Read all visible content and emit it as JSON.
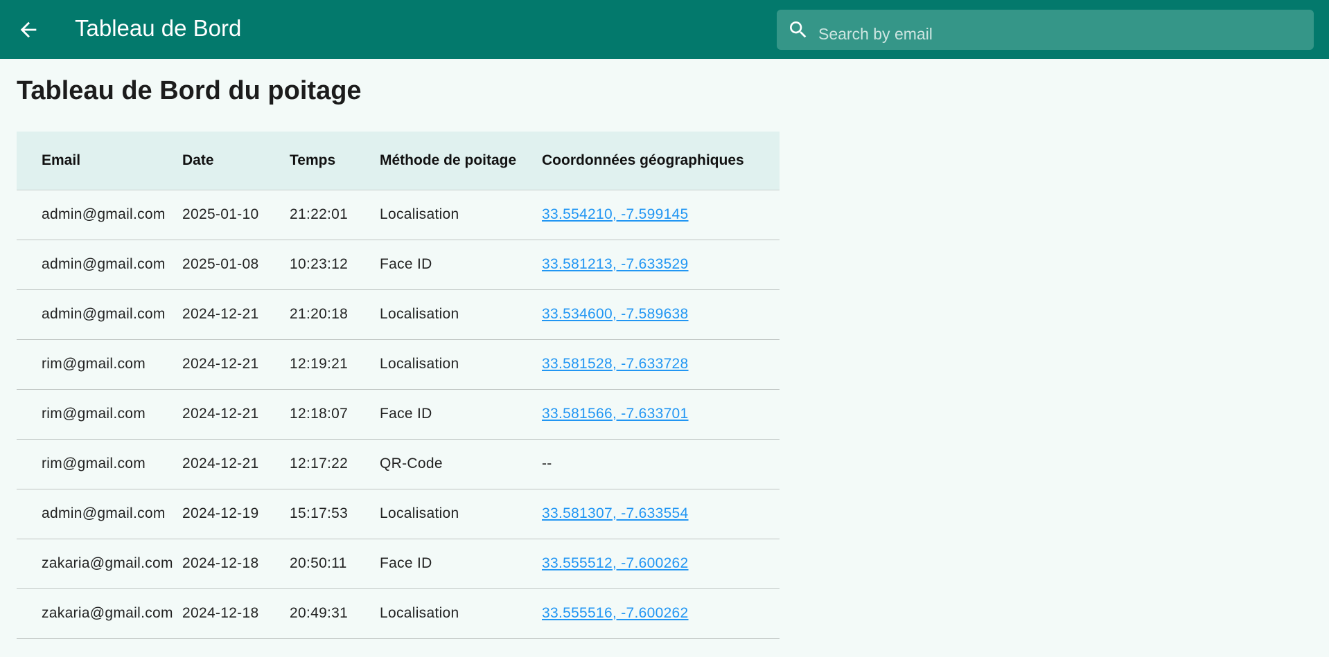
{
  "appbar": {
    "title": "Tableau de Bord",
    "back_icon": "arrow-back-icon",
    "search": {
      "placeholder": "Search by email",
      "value": "",
      "icon": "search-icon"
    }
  },
  "page": {
    "title": "Tableau de Bord du poitage"
  },
  "colors": {
    "appbar": "#03796c",
    "search_bg": "#359688",
    "header_row": "#e0f1ef",
    "link": "#2196f3",
    "background": "#f3faf8"
  },
  "table": {
    "headers": {
      "email": "Email",
      "date": "Date",
      "time": "Temps",
      "method": "Méthode de poitage",
      "coords": "Coordonnées géographiques"
    },
    "rows": [
      {
        "email": "admin@gmail.com",
        "date": "2025-01-10",
        "time": "21:22:01",
        "method": "Localisation",
        "coords": "33.554210, -7.599145"
      },
      {
        "email": "admin@gmail.com",
        "date": "2025-01-08",
        "time": "10:23:12",
        "method": "Face ID",
        "coords": "33.581213, -7.633529"
      },
      {
        "email": "admin@gmail.com",
        "date": "2024-12-21",
        "time": "21:20:18",
        "method": "Localisation",
        "coords": "33.534600, -7.589638"
      },
      {
        "email": "rim@gmail.com",
        "date": "2024-12-21",
        "time": "12:19:21",
        "method": "Localisation",
        "coords": "33.581528, -7.633728"
      },
      {
        "email": "rim@gmail.com",
        "date": "2024-12-21",
        "time": "12:18:07",
        "method": "Face ID",
        "coords": "33.581566, -7.633701"
      },
      {
        "email": "rim@gmail.com",
        "date": "2024-12-21",
        "time": "12:17:22",
        "method": "QR-Code",
        "coords": "--"
      },
      {
        "email": "admin@gmail.com",
        "date": "2024-12-19",
        "time": "15:17:53",
        "method": "Localisation",
        "coords": "33.581307, -7.633554"
      },
      {
        "email": "zakaria@gmail.com",
        "date": "2024-12-18",
        "time": "20:50:11",
        "method": "Face ID",
        "coords": "33.555512, -7.600262"
      },
      {
        "email": "zakaria@gmail.com",
        "date": "2024-12-18",
        "time": "20:49:31",
        "method": "Localisation",
        "coords": "33.555516, -7.600262"
      }
    ]
  }
}
